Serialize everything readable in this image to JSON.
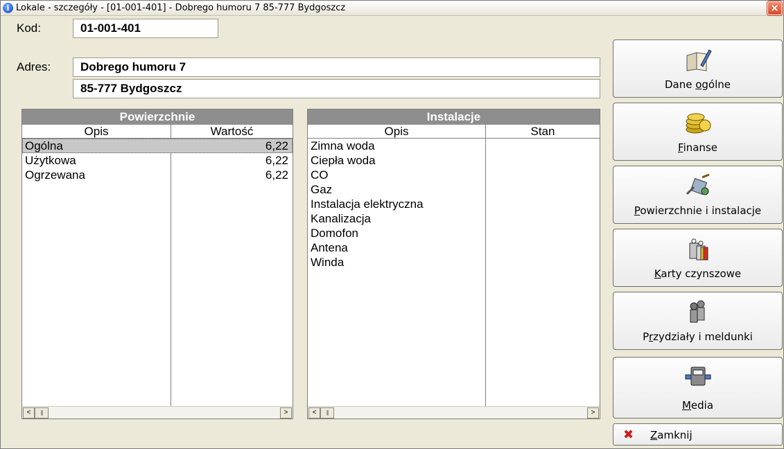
{
  "window": {
    "title": "Lokale - szczegóły - [01-001-401] - Dobrego humoru 7 85-777 Bydgoszcz",
    "close_label": "×"
  },
  "form": {
    "kod_label": "Kod:",
    "kod_value": "01-001-401",
    "adres_label": "Adres:",
    "adres_line1": "Dobrego humoru 7",
    "adres_line2": "85-777 Bydgoszcz"
  },
  "powierzchnie": {
    "title": "Powierzchnie",
    "col_opis": "Opis",
    "col_wartosc": "Wartość",
    "rows": [
      {
        "opis": "Ogólna",
        "wartosc": "6,22",
        "selected": true
      },
      {
        "opis": "Użytkowa",
        "wartosc": "6,22"
      },
      {
        "opis": "Ogrzewana",
        "wartosc": "6,22"
      }
    ]
  },
  "instalacje": {
    "title": "Instalacje",
    "col_opis": "Opis",
    "col_stan": "Stan",
    "rows": [
      {
        "opis": "Zimna woda",
        "stan": ""
      },
      {
        "opis": "Ciepła woda",
        "stan": ""
      },
      {
        "opis": "CO",
        "stan": ""
      },
      {
        "opis": "Gaz",
        "stan": ""
      },
      {
        "opis": "Instalacja elektryczna",
        "stan": ""
      },
      {
        "opis": "Kanalizacja",
        "stan": ""
      },
      {
        "opis": "Domofon",
        "stan": ""
      },
      {
        "opis": "Antena",
        "stan": ""
      },
      {
        "opis": "Winda",
        "stan": ""
      }
    ]
  },
  "sidebar": {
    "buttons": [
      {
        "pre": "Dane ",
        "key": "o",
        "post": "gólne",
        "icon": "book-pen-icon"
      },
      {
        "pre": "",
        "key": "F",
        "post": "inanse",
        "icon": "coins-icon"
      },
      {
        "pre": "",
        "key": "P",
        "post": "owierzchnie i instalacje",
        "icon": "tools-icon"
      },
      {
        "pre": "",
        "key": "K",
        "post": "arty czynszowe",
        "icon": "gifts-icon"
      },
      {
        "pre": "P",
        "key": "r",
        "post": "zydziały i meldunki",
        "icon": "people-icon"
      },
      {
        "pre": "",
        "key": "M",
        "post": "edia",
        "icon": "meter-icon"
      }
    ],
    "close": {
      "pre": "",
      "key": "Z",
      "post": "amknij",
      "icon": "close-x-icon",
      "x": "✖"
    }
  },
  "scroll": {
    "left": "<",
    "right": ">",
    "grip": "|||"
  },
  "colors": {
    "panel_header": "#8e8e8e",
    "window_bg": "#ece9d8",
    "close_red": "#d01818"
  }
}
